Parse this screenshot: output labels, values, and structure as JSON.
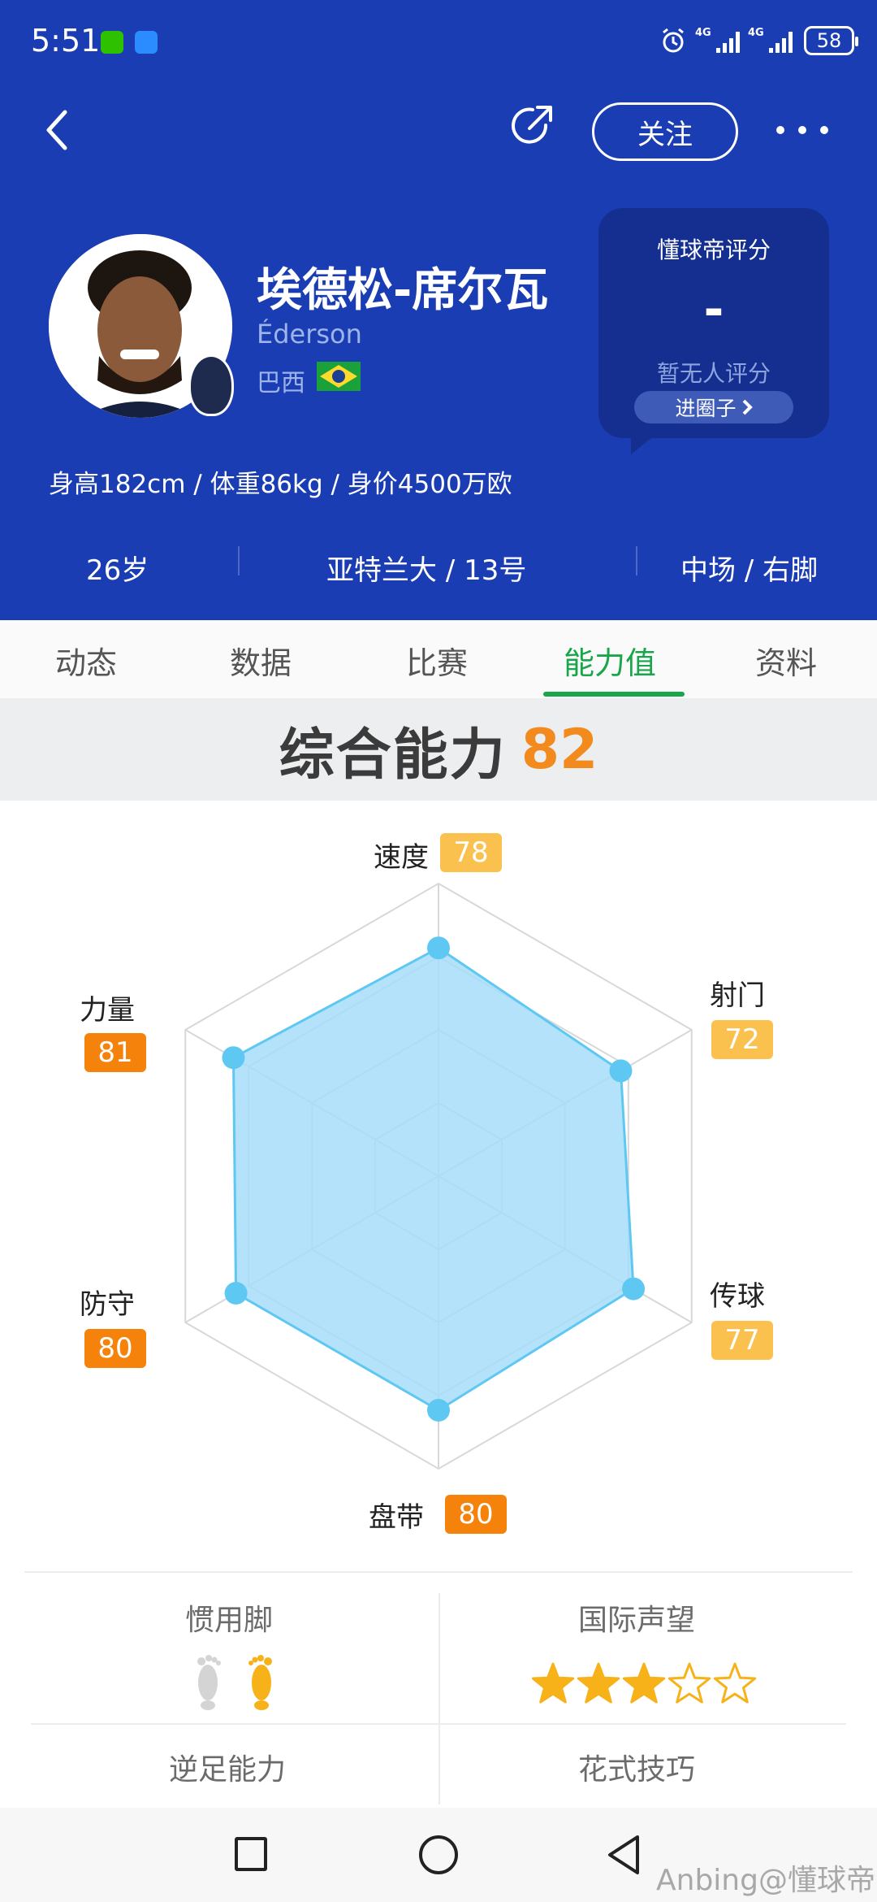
{
  "status_bar": {
    "time": "5:51",
    "signal1": "4G",
    "signal2": "4G",
    "battery": "58"
  },
  "header": {
    "follow_label": "关注"
  },
  "player": {
    "name": "埃德松-席尔瓦",
    "name_en": "Éderson",
    "country": "巴西",
    "info": "身高182cm / 体重86kg / 身价4500万欧",
    "age": "26岁",
    "club_number": "亚特兰大 / 13号",
    "position_foot": "中场 / 右脚"
  },
  "rating": {
    "title": "懂球帝评分",
    "value": "-",
    "empty_text": "暂无人评分",
    "circle_label": "进圈子"
  },
  "tabs": [
    {
      "label": "动态"
    },
    {
      "label": "数据"
    },
    {
      "label": "比赛"
    },
    {
      "label": "能力值"
    },
    {
      "label": "资料"
    }
  ],
  "active_tab": "能力值",
  "overall": {
    "label": "综合能力",
    "value": "82"
  },
  "colors": {
    "header_blue": "#1a3db3",
    "accent_green": "#19a64a",
    "stat_orange": "#f5820a",
    "stat_yellow": "#fbc14e",
    "radar_fill": "#a6ddf9",
    "radar_stroke": "#5ec8f2"
  },
  "chart_data": {
    "type": "radar",
    "max": 100,
    "categories": [
      "速度",
      "射门",
      "传球",
      "盘带",
      "防守",
      "力量"
    ],
    "values": [
      78,
      72,
      77,
      80,
      80,
      81
    ],
    "labels": [
      "78",
      "72",
      "77",
      "80",
      "80",
      "81"
    ],
    "value_badge_colors": [
      "#fbc14e",
      "#fbc14e",
      "#fbc14e",
      "#f5820a",
      "#f5820a",
      "#f5820a"
    ]
  },
  "sections": {
    "preferred_foot": "惯用脚",
    "preferred_foot_value": "right",
    "reputation": "国际声望",
    "reputation_stars": 3,
    "reputation_max": 5,
    "weak_foot": "逆足能力",
    "skill_moves": "花式技巧"
  },
  "icons": {
    "back": "back-arrow-icon",
    "share": "share-icon",
    "more": "more-dots-icon",
    "foot": "footprint-icon",
    "star": "star-icon"
  },
  "watermark": "Anbing@懂球帝"
}
